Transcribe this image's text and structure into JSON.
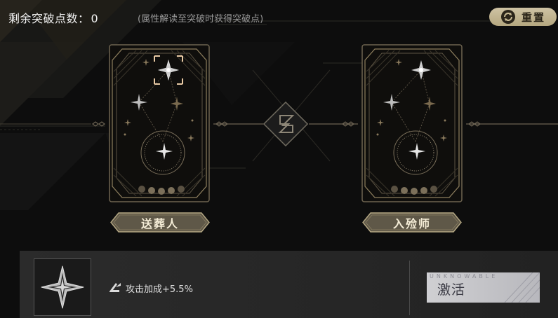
{
  "header": {
    "points_label": "剩余突破点数：",
    "points_value": "0",
    "hint": "(属性解读至突破时获得突破点)"
  },
  "reset_button": {
    "label": "重置",
    "icon": "refresh-icon"
  },
  "cards": [
    {
      "name": "送葬人",
      "selected_node": "top-star"
    },
    {
      "name": "入殓师"
    }
  ],
  "detail": {
    "icon": "compass-star-icon",
    "effect_icon": "attack-icon",
    "effect_text": "攻击加成+5.5%"
  },
  "activate_button": {
    "label": "激活",
    "watermark": "UNKNOWABLE"
  },
  "colors": {
    "accent_gold": "#c9b98f",
    "card_line": "#8e7f5e",
    "button_grey": "#c6c6ca"
  }
}
